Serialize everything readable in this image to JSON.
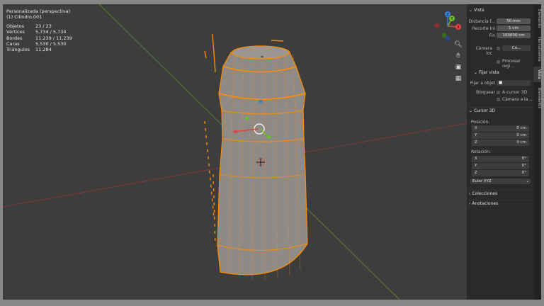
{
  "viewport": {
    "view_name": "Personalizada (perspectiva)",
    "object_name": "(1) Cilindro.001",
    "stats": [
      {
        "label": "Objetos",
        "value": "23 / 23"
      },
      {
        "label": "Vértices",
        "value": "5,734 / 5,734"
      },
      {
        "label": "Bordes",
        "value": "11,239 / 11,239"
      },
      {
        "label": "Caras",
        "value": "5,530 / 5,530"
      },
      {
        "label": "Triángulos",
        "value": "11,284"
      }
    ],
    "gizmo": {
      "x": "X",
      "y": "Y",
      "z": "Z"
    }
  },
  "colors": {
    "accent": "#ff8c00",
    "x_axis": "#e54040",
    "y_axis": "#6bbf2a",
    "z_axis": "#3a7fe0"
  },
  "nav_icons": [
    "zoom-icon",
    "hand-icon",
    "camera-icon",
    "grid-icon"
  ],
  "panel": {
    "vista": {
      "title": "Vista",
      "focal_label": "Distancia f...",
      "focal_value": "50 mm",
      "clip_start_label": "Recorte  Ini",
      "clip_start_value": "1 cm",
      "clip_end_label": "Fin",
      "clip_end_value": "100000 cm",
      "local_camera_label": "Cámara loc",
      "local_camera_value": "Cá...",
      "render_region_label": "Procesar regi..."
    },
    "lock": {
      "title": "Fijar vista",
      "lock_object_label": "Fijar a objet",
      "lock_label": "Bloquear",
      "to_cursor_label": "A cursor 3D",
      "camera_to_view_label": "Cámara a la ..."
    },
    "cursor": {
      "title": "Cursor 3D",
      "position_label": "Posición:",
      "position": [
        {
          "axis": "X",
          "value": "0 cm"
        },
        {
          "axis": "Y",
          "value": "0 cm"
        },
        {
          "axis": "Z",
          "value": "0 cm"
        }
      ],
      "rotation_label": "Rotación:",
      "rotation": [
        {
          "axis": "X",
          "value": "0°"
        },
        {
          "axis": "Y",
          "value": "0°"
        },
        {
          "axis": "Z",
          "value": "0°"
        }
      ],
      "rotation_mode": "Euler XYZ"
    },
    "collections": "Colecciones",
    "annotations": "Anotaciones"
  },
  "tabs": [
    "Elemento",
    "Herramienta",
    "Vista",
    "BlenderKit"
  ]
}
